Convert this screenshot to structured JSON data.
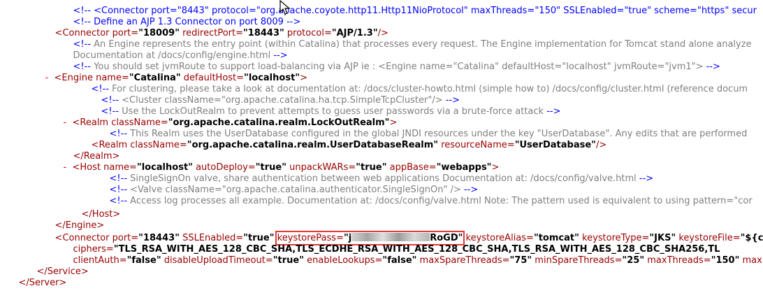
{
  "lines": {
    "l0a": "<!-- <Connector port=\"8443\" protocol=\"org.apache.coyote.http11.Http11NioProtocol\" maxThreads=\"150\" SSLEnabled=\"true\" scheme=\"https\" secur",
    "l0b": "<!-- Define an AJP 1.3 Connector on port 8009 -->",
    "l1": {
      "open": "<",
      "tag": "Connector",
      "a1": " port=",
      "v1": "\"18009\"",
      "a2": " redirectPort=",
      "v2": "\"18443\"",
      "a3": " protocol=",
      "v3": "\"AJP/1.3\"",
      "close": "/>"
    },
    "l2a_start": "<!-- ",
    "l2a": "An Engine represents the entry point (within Catalina) that processes every request. The Engine implementation for Tomcat stand alone analyze",
    "l2b": "Documentation at /docs/config/engine.html ",
    "l2b_end": "-->",
    "l3_start": "<!-- ",
    "l3": "You should set jvmRoute to support load-balancing via AJP ie : <Engine name=\"Catalina\" defaultHost=\"localhost\" jvmRoute=\"jvm1\">",
    "l3_end": " -->",
    "l4": {
      "marker": "-",
      "open": "<",
      "tag": "Engine",
      "a1": " name=",
      "v1": "\"Catalina\"",
      "a2": " defaultHost=",
      "v2": "\"localhost\"",
      "close": ">"
    },
    "l5_start": "<!-- ",
    "l5": "For clustering, please take a look at documentation at: /docs/cluster-howto.html (simple how to) /docs/config/cluster.html (reference docum",
    "l6_start": "<!-- ",
    "l6": "<Cluster className=\"org.apache.catalina.ha.tcp.SimpleTcpCluster\"/>",
    "l6_end": " -->",
    "l7_start": "<!-- ",
    "l7": "Use the LockOutRealm to prevent attempts to guess user passwords via a brute-force attack",
    "l7_end": " -->",
    "l8": {
      "marker": "-",
      "open": "<",
      "tag": "Realm",
      "a1": " className=",
      "v1": "\"org.apache.catalina.realm.LockOutRealm\"",
      "close": ">"
    },
    "l9_start": "<!-- ",
    "l9": "This Realm uses the UserDatabase configured in the global JNDI resources under the key \"UserDatabase\". Any edits that are performed",
    "l10": {
      "open": "<",
      "tag": "Realm",
      "a1": " className=",
      "v1": "\"org.apache.catalina.realm.UserDatabaseRealm\"",
      "a2": " resourceName=",
      "v2": "\"UserDatabase\"",
      "close": "/>"
    },
    "l11": "</Realm>",
    "l12": {
      "marker": "-",
      "open": "<",
      "tag": "Host",
      "a1": " name=",
      "v1": "\"localhost\"",
      "a2": " autoDeploy=",
      "v2": "\"true\"",
      "a3": " unpackWARs=",
      "v3": "\"true\"",
      "a4": " appBase=",
      "v4": "\"webapps\"",
      "close": ">"
    },
    "l13_start": "<!-- ",
    "l13": "SingleSignOn valve, share authentication between web applications Documentation at: /docs/config/valve.html",
    "l13_end": " -->",
    "l14_start": "<!-- ",
    "l14": "<Valve className=\"org.apache.catalina.authenticator.SingleSignOn\" />",
    "l14_end": " -->",
    "l15_start": "<!-- ",
    "l15": "Access log processes all example. Documentation at: /docs/config/valve.html Note: The pattern used is equivalent to using pattern=\"cor",
    "l16": "</Host>",
    "l17": "</Engine>",
    "l18": {
      "open": "<",
      "tag": "Connector",
      "a1": " port=",
      "v1": "\"18443\"",
      "a2": " SSLEnabled=",
      "v2": "\"true\"",
      "hl_attr": "keystorePass=",
      "hl_q": "\"j",
      "hl_tail": "RoGD\"",
      "a4": "keystoreAlias=",
      "v4": "\"tomcat\"",
      "a5": " keystoreType=",
      "v5": "\"JKS\"",
      "a6": " keystoreFile=",
      "v6": "\"${c"
    },
    "l19": {
      "a1": "ciphers=",
      "v1": "\"TLS_RSA_WITH_AES_128_CBC_SHA,TLS_ECDHE_RSA_WITH_AES_128_CBC_SHA,TLS_RSA_WITH_AES_128_CBC_SHA256,TL"
    },
    "l20": {
      "a1": "clientAuth=",
      "v1": "\"false\"",
      "a2": " disableUploadTimeout=",
      "v2": "\"true\"",
      "a3": " enableLookups=",
      "v3": "\"false\"",
      "a4": " maxSpareThreads=",
      "v4": "\"75\"",
      "a5": " minSpareThreads=",
      "v5": "\"25\"",
      "a6": " maxThreads=",
      "v6": "\"150\"",
      "a7": " maxH"
    },
    "l21": "</Service>",
    "l22": "</Server>"
  },
  "icons": {
    "cursor": "mouse-pointer-icon",
    "collapse": "collapse-minus-icon"
  },
  "colors": {
    "tag": "#990000",
    "comment": "#0000ff",
    "comment_text": "#808080",
    "highlight_box": "#e53935"
  }
}
